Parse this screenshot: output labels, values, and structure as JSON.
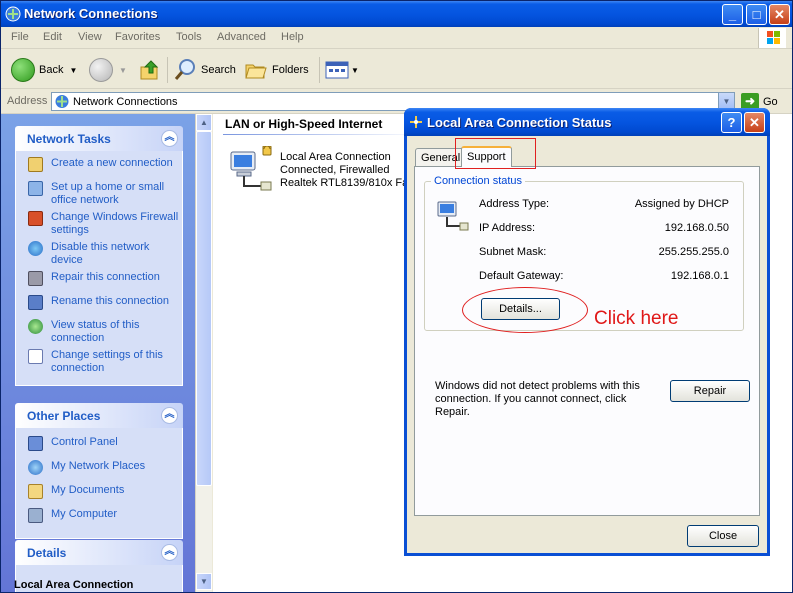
{
  "window": {
    "title": "Network Connections"
  },
  "menu": [
    "File",
    "Edit",
    "View",
    "Favorites",
    "Tools",
    "Advanced",
    "Help"
  ],
  "toolbar": {
    "back": "Back",
    "search": "Search",
    "folders": "Folders"
  },
  "address": {
    "label": "Address",
    "value": "Network Connections",
    "go": "Go"
  },
  "tasks": {
    "network_tasks": {
      "title": "Network Tasks",
      "items": [
        "Create a new connection",
        "Set up a home or small office network",
        "Change Windows Firewall settings",
        "Disable this network device",
        "Repair this connection",
        "Rename this connection",
        "View status of this connection",
        "Change settings of this connection"
      ]
    },
    "other_places": {
      "title": "Other Places",
      "items": [
        "Control Panel",
        "My Network Places",
        "My Documents",
        "My Computer"
      ]
    },
    "details": {
      "title": "Details",
      "text": "Local Area Connection"
    }
  },
  "content": {
    "section": "LAN or High-Speed Internet",
    "connection": {
      "name": "Local Area Connection",
      "status": "Connected, Firewalled",
      "device": "Realtek RTL8139/810x Fa"
    }
  },
  "dialog": {
    "title": "Local Area Connection Status",
    "tabs": [
      "General",
      "Support"
    ],
    "group": "Connection status",
    "rows": [
      {
        "k": "Address Type:",
        "v": "Assigned by DHCP"
      },
      {
        "k": "IP Address:",
        "v": "192.168.0.50"
      },
      {
        "k": "Subnet Mask:",
        "v": "255.255.255.0"
      },
      {
        "k": "Default Gateway:",
        "v": "192.168.0.1"
      }
    ],
    "details_btn": "Details...",
    "message": "Windows did not detect problems with this connection. If you cannot connect, click Repair.",
    "repair_btn": "Repair",
    "close_btn": "Close"
  },
  "annotation": {
    "text": "Click here",
    "color": "#e01818"
  }
}
